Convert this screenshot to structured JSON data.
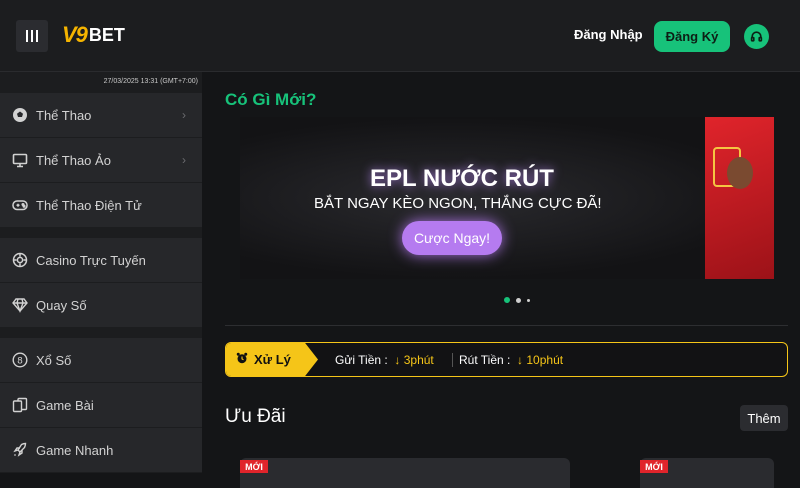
{
  "header": {
    "login_label": "Đăng Nhập",
    "register_label": "Đăng Ký",
    "logo_v9": "V9",
    "logo_bet": "BET"
  },
  "sidebar": {
    "datetime": "27/03/2025 13:31 (GMT+7:00)",
    "items": [
      {
        "label": "Thể Thao",
        "icon": "soccer-ball-icon",
        "chevron": true
      },
      {
        "label": "Thể Thao Ảo",
        "icon": "monitor-icon",
        "chevron": true
      },
      {
        "label": "Thể Thao Điện Tử",
        "icon": "gamepad-icon",
        "chevron": false
      },
      {
        "label": "Casino Trực Tuyến",
        "icon": "casino-chip-icon",
        "chevron": false
      },
      {
        "label": "Quay Số",
        "icon": "diamond-icon",
        "chevron": false
      },
      {
        "label": "Xổ Số",
        "icon": "lottery-ball-icon",
        "chevron": false
      },
      {
        "label": "Game Bài",
        "icon": "cards-icon",
        "chevron": false
      },
      {
        "label": "Game Nhanh",
        "icon": "rocket-icon",
        "chevron": false
      }
    ]
  },
  "main": {
    "whats_new_title": "Có Gì Mới?",
    "banner": {
      "headline": "EPL NƯỚC RÚT",
      "subtitle": "BẮT NGAY KÈO NGON, THẮNG CỰC ĐÃ!",
      "cta_label": "Cược Ngay!"
    },
    "process": {
      "tag_label": "Xử Lý",
      "deposit_label": "Gửi Tiền :",
      "deposit_value": "3phút",
      "withdraw_label": "Rút Tiền :",
      "withdraw_value": "10phút"
    },
    "promotions_title": "Ưu Đãi",
    "more_label": "Thêm",
    "new_badge": "MỚI"
  },
  "colors": {
    "accent_green": "#17c27a",
    "accent_yellow": "#f5c518",
    "background": "#141517",
    "sidebar_item": "#26272a"
  }
}
